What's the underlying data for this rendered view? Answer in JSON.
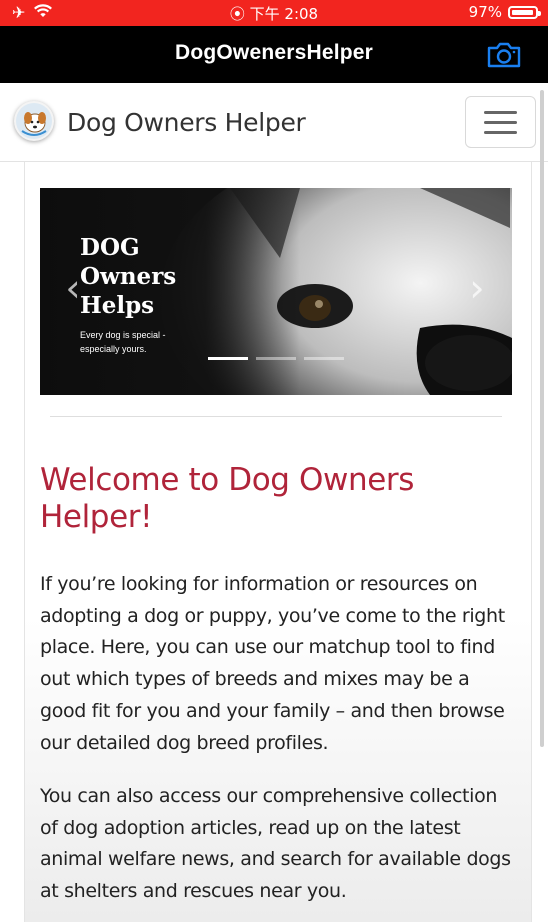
{
  "status_bar": {
    "center_text": "⦿ 下午 2:08",
    "battery_text": "97%",
    "battery_level": 0.97
  },
  "app_bar": {
    "title": "DogOwenersHelper",
    "camera_icon": "camera-icon"
  },
  "site_header": {
    "brand": "Dog Owners Helper",
    "menu_icon": "hamburger-icon"
  },
  "carousel": {
    "title": "DOG\nOwners\nHelps",
    "subtitle": "Every dog is special - especially yours.",
    "prev_icon": "chevron-left-icon",
    "next_icon": "chevron-right-icon",
    "slide_count": 3,
    "active_slide": 1
  },
  "content": {
    "heading": "Welcome to Dog Owners Helper!",
    "paragraph1": "If you’re looking for information or resources on adopting a dog or puppy, you’ve come to the right place. Here, you can use our matchup tool to find out which types of breeds and mixes may be a good fit for you and your family – and then browse our detailed dog breed profiles.",
    "paragraph2": "You can also access our comprehensive collection of dog adoption articles, read up on the latest animal welfare news, and search for available dogs at shelters and rescues near you."
  },
  "colors": {
    "status_bar_bg": "#f2251f",
    "app_bar_bg": "#000000",
    "heading_color": "#b0243a",
    "camera_color": "#1a7ff0"
  }
}
